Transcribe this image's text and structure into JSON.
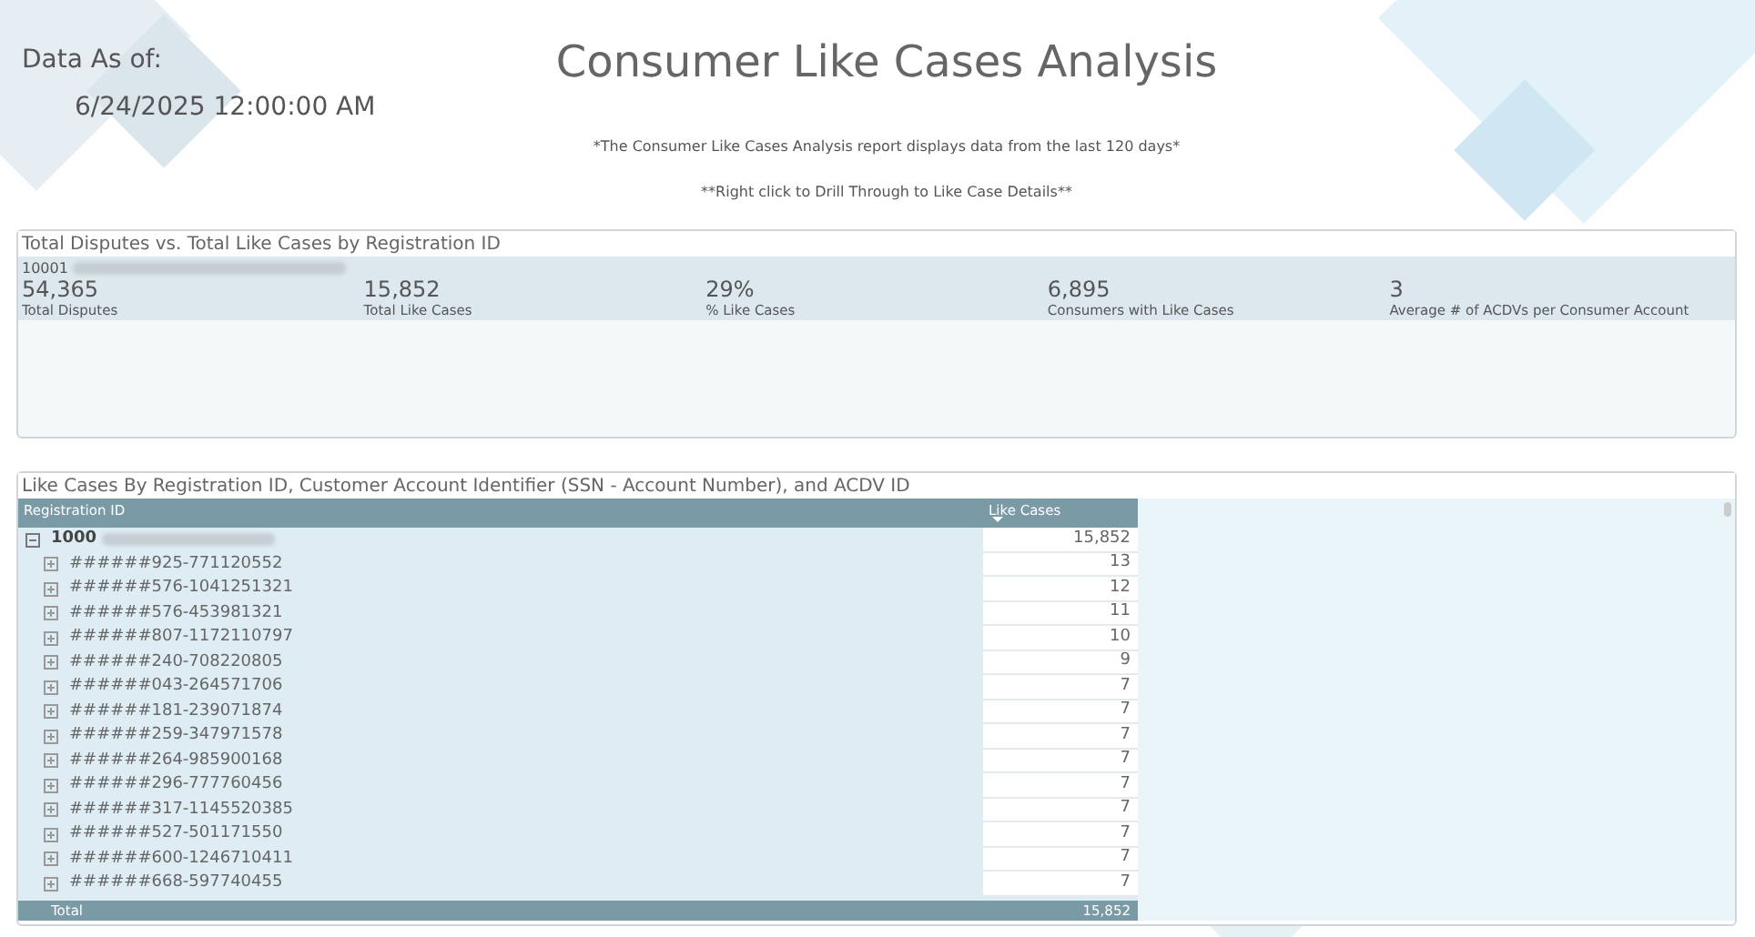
{
  "header": {
    "data_as_of_label": "Data As of:",
    "data_as_of_value": "6/24/2025 12:00:00 AM",
    "title": "Consumer Like Cases Analysis",
    "note": "*The Consumer Like Cases Analysis report displays data from the last 120 days*",
    "drill_hint": "**Right click to Drill Through to Like Case Details**"
  },
  "summary_panel": {
    "title": "Total Disputes vs. Total Like Cases by Registration ID",
    "registration_id": "10001",
    "metrics": [
      {
        "value": "54,365",
        "label": "Total Disputes"
      },
      {
        "value": "15,852",
        "label": "Total Like Cases"
      },
      {
        "value": "29%",
        "label": "% Like Cases"
      },
      {
        "value": "6,895",
        "label": "Consumers with Like Cases"
      },
      {
        "value": "3",
        "label": "Average # of ACDVs per Consumer Account"
      }
    ]
  },
  "table_panel": {
    "title": "Like Cases By Registration ID, Customer Account Identifier (SSN - Account Number), and ACDV ID",
    "columns": [
      "Registration ID",
      "Like Cases"
    ],
    "rows": [
      {
        "registration_id": "1000",
        "like_cases": "15,852",
        "expanded": true,
        "children": [
          {
            "registration_id": "######925-771120552",
            "like_cases": "13",
            "expanded": false
          },
          {
            "registration_id": "######576-1041251321",
            "like_cases": "12",
            "expanded": false
          },
          {
            "registration_id": "######576-453981321",
            "like_cases": "11",
            "expanded": false
          },
          {
            "registration_id": "######807-1172110797",
            "like_cases": "10",
            "expanded": false
          },
          {
            "registration_id": "######240-708220805",
            "like_cases": "9",
            "expanded": false
          },
          {
            "registration_id": "######043-264571706",
            "like_cases": "7",
            "expanded": false
          },
          {
            "registration_id": "######181-239071874",
            "like_cases": "7",
            "expanded": false
          },
          {
            "registration_id": "######259-347971578",
            "like_cases": "7",
            "expanded": false
          },
          {
            "registration_id": "######264-985900168",
            "like_cases": "7",
            "expanded": false
          },
          {
            "registration_id": "######296-777760456",
            "like_cases": "7",
            "expanded": false
          },
          {
            "registration_id": "######317-1145520385",
            "like_cases": "7",
            "expanded": false
          },
          {
            "registration_id": "######527-501171550",
            "like_cases": "7",
            "expanded": false
          },
          {
            "registration_id": "######600-1246710411",
            "like_cases": "7",
            "expanded": false
          },
          {
            "registration_id": "######668-597740455",
            "like_cases": "7",
            "expanded": false
          }
        ]
      }
    ],
    "total": {
      "label": "Total",
      "like_cases": "15,852"
    }
  }
}
